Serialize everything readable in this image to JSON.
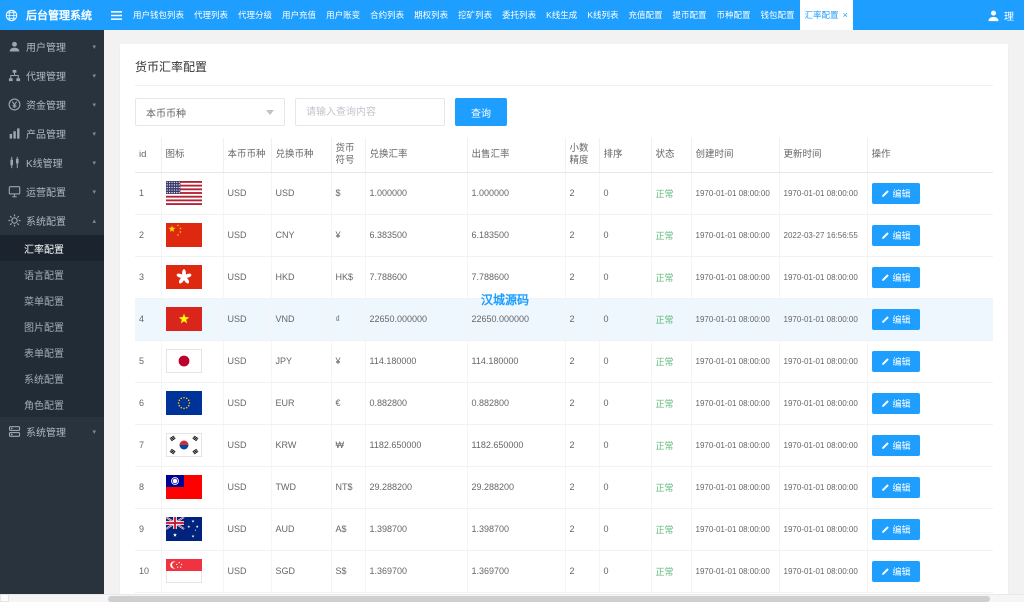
{
  "topbar": {
    "brand": "后台管理系统",
    "user_label": "理",
    "tabs": [
      {
        "label": "用户钱包列表",
        "active": false
      },
      {
        "label": "代理列表",
        "active": false
      },
      {
        "label": "代理分级",
        "active": false
      },
      {
        "label": "用户充值",
        "active": false
      },
      {
        "label": "用户账变",
        "active": false
      },
      {
        "label": "合约列表",
        "active": false
      },
      {
        "label": "期权列表",
        "active": false
      },
      {
        "label": "挖矿列表",
        "active": false
      },
      {
        "label": "委托列表",
        "active": false
      },
      {
        "label": "K线生成",
        "active": false
      },
      {
        "label": "K线列表",
        "active": false
      },
      {
        "label": "充值配置",
        "active": false
      },
      {
        "label": "提币配置",
        "active": false
      },
      {
        "label": "币种配置",
        "active": false
      },
      {
        "label": "钱包配置",
        "active": false
      },
      {
        "label": "汇率配置",
        "active": true,
        "closable": true
      }
    ]
  },
  "sidebar": {
    "items": [
      {
        "label": "用户管理",
        "icon": "users-icon",
        "caret": "down"
      },
      {
        "label": "代理管理",
        "icon": "agents-icon",
        "caret": "down"
      },
      {
        "label": "资金管理",
        "icon": "funds-icon",
        "caret": "down"
      },
      {
        "label": "产品管理",
        "icon": "products-icon",
        "caret": "down"
      },
      {
        "label": "K线管理",
        "icon": "kline-icon",
        "caret": "down"
      },
      {
        "label": "运营配置",
        "icon": "operations-icon",
        "caret": "down"
      },
      {
        "label": "系统配置",
        "icon": "system-config-icon",
        "caret": "up",
        "expanded": true,
        "children": [
          {
            "label": "汇率配置",
            "active": true
          },
          {
            "label": "语言配置",
            "active": false
          },
          {
            "label": "菜单配置",
            "active": false
          },
          {
            "label": "图片配置",
            "active": false
          },
          {
            "label": "表单配置",
            "active": false
          },
          {
            "label": "系统配置",
            "active": false
          },
          {
            "label": "角色配置",
            "active": false
          }
        ]
      },
      {
        "label": "系统管理",
        "icon": "system-manage-icon",
        "caret": "down"
      }
    ]
  },
  "main": {
    "page_title": "货币汇率配置",
    "filter": {
      "currency_select_value": "本币币种",
      "search_placeholder": "请输入查询内容",
      "search_button": "查询"
    },
    "watermark": "汉城源码",
    "table": {
      "columns": [
        "id",
        "图标",
        "本币币种",
        "兑换币种",
        "货币符号",
        "兑换汇率",
        "出售汇率",
        "小数精度",
        "排序",
        "状态",
        "创建时间",
        "更新时间",
        "操作"
      ],
      "edit_button": "编辑",
      "highlighted_row": 4,
      "rows": [
        {
          "id": "1",
          "flag": "us",
          "base": "USD",
          "quote": "USD",
          "symbol": "$",
          "exchange_rate": "1.000000",
          "sell_rate": "1.000000",
          "precision": "2",
          "sort": "0",
          "status": "正常",
          "created_at": "1970-01-01 08:00:00",
          "updated_at": "1970-01-01 08:00:00"
        },
        {
          "id": "2",
          "flag": "cn",
          "base": "USD",
          "quote": "CNY",
          "symbol": "¥",
          "exchange_rate": "6.383500",
          "sell_rate": "6.183500",
          "precision": "2",
          "sort": "0",
          "status": "正常",
          "created_at": "1970-01-01 08:00:00",
          "updated_at": "2022-03-27 16:56:55"
        },
        {
          "id": "3",
          "flag": "hk",
          "base": "USD",
          "quote": "HKD",
          "symbol": "HK$",
          "exchange_rate": "7.788600",
          "sell_rate": "7.788600",
          "precision": "2",
          "sort": "0",
          "status": "正常",
          "created_at": "1970-01-01 08:00:00",
          "updated_at": "1970-01-01 08:00:00"
        },
        {
          "id": "4",
          "flag": "vn",
          "base": "USD",
          "quote": "VND",
          "symbol": "₫",
          "exchange_rate": "22650.000000",
          "sell_rate": "22650.000000",
          "precision": "2",
          "sort": "0",
          "status": "正常",
          "created_at": "1970-01-01 08:00:00",
          "updated_at": "1970-01-01 08:00:00"
        },
        {
          "id": "5",
          "flag": "jp",
          "base": "USD",
          "quote": "JPY",
          "symbol": "¥",
          "exchange_rate": "114.180000",
          "sell_rate": "114.180000",
          "precision": "2",
          "sort": "0",
          "status": "正常",
          "created_at": "1970-01-01 08:00:00",
          "updated_at": "1970-01-01 08:00:00"
        },
        {
          "id": "6",
          "flag": "eu",
          "base": "USD",
          "quote": "EUR",
          "symbol": "€",
          "exchange_rate": "0.882800",
          "sell_rate": "0.882800",
          "precision": "2",
          "sort": "0",
          "status": "正常",
          "created_at": "1970-01-01 08:00:00",
          "updated_at": "1970-01-01 08:00:00"
        },
        {
          "id": "7",
          "flag": "kr",
          "base": "USD",
          "quote": "KRW",
          "symbol": "₩",
          "exchange_rate": "1182.650000",
          "sell_rate": "1182.650000",
          "precision": "2",
          "sort": "0",
          "status": "正常",
          "created_at": "1970-01-01 08:00:00",
          "updated_at": "1970-01-01 08:00:00"
        },
        {
          "id": "8",
          "flag": "tw",
          "base": "USD",
          "quote": "TWD",
          "symbol": "NT$",
          "exchange_rate": "29.288200",
          "sell_rate": "29.288200",
          "precision": "2",
          "sort": "0",
          "status": "正常",
          "created_at": "1970-01-01 08:00:00",
          "updated_at": "1970-01-01 08:00:00"
        },
        {
          "id": "9",
          "flag": "au",
          "base": "USD",
          "quote": "AUD",
          "symbol": "A$",
          "exchange_rate": "1.398700",
          "sell_rate": "1.398700",
          "precision": "2",
          "sort": "0",
          "status": "正常",
          "created_at": "1970-01-01 08:00:00",
          "updated_at": "1970-01-01 08:00:00"
        },
        {
          "id": "10",
          "flag": "sg",
          "base": "USD",
          "quote": "SGD",
          "symbol": "S$",
          "exchange_rate": "1.369700",
          "sell_rate": "1.369700",
          "precision": "2",
          "sort": "0",
          "status": "正常",
          "created_at": "1970-01-01 08:00:00",
          "updated_at": "1970-01-01 08:00:00"
        }
      ]
    }
  },
  "colors": {
    "accent_blue": "#1E9FFF",
    "status_green": "#5FB878",
    "sidebar_dark": "#28333E"
  }
}
